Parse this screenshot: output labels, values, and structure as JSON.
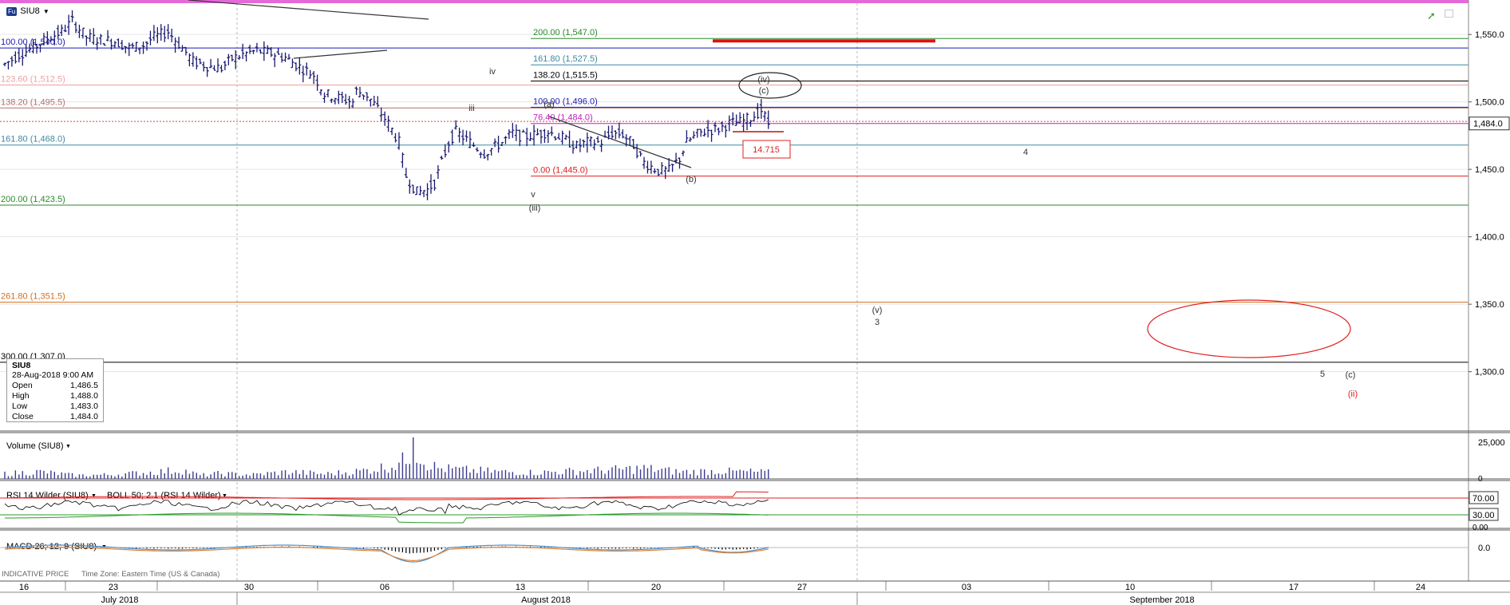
{
  "symbol": "SIU8",
  "symbol_badge": "Fu",
  "chart_data": {
    "type": "ohlc",
    "title": "SIU8",
    "y_axis": {
      "range": [
        1256,
        1572
      ],
      "ticks": [
        1300,
        1350,
        1400,
        1450,
        1500,
        1550
      ],
      "tick_labels": [
        "1,300.0",
        "1,350.0",
        "1,400.0",
        "1,450.0",
        "1,500.0",
        "1,550.0"
      ]
    },
    "last_price_label": "1,484.0",
    "x_axis": {
      "ticks": [
        "16",
        "23",
        "30",
        "06",
        "13",
        "20",
        "27",
        "03",
        "10",
        "17",
        "24"
      ],
      "months": [
        "July 2018",
        "August 2018",
        "September 2018"
      ]
    },
    "price_path": [
      [
        0,
        1528
      ],
      [
        4,
        1535
      ],
      [
        8,
        1540
      ],
      [
        12,
        1547
      ],
      [
        16,
        1552
      ],
      [
        19,
        1560
      ],
      [
        23,
        1548
      ],
      [
        27,
        1546
      ],
      [
        31,
        1545
      ],
      [
        35,
        1540
      ],
      [
        39,
        1542
      ],
      [
        42,
        1548
      ],
      [
        46,
        1552
      ],
      [
        50,
        1540
      ],
      [
        53,
        1530
      ],
      [
        58,
        1526
      ],
      [
        61,
        1525
      ],
      [
        64,
        1532
      ],
      [
        68,
        1536
      ],
      [
        71,
        1538
      ],
      [
        75,
        1536
      ],
      [
        79,
        1533
      ],
      [
        83,
        1526
      ],
      [
        87,
        1520
      ],
      [
        90,
        1506
      ],
      [
        94,
        1503
      ],
      [
        98,
        1500
      ],
      [
        99,
        1508
      ],
      [
        102,
        1505
      ],
      [
        105,
        1495
      ],
      [
        108,
        1484
      ],
      [
        111,
        1470
      ],
      [
        113,
        1445
      ],
      [
        116,
        1433
      ],
      [
        119,
        1435
      ],
      [
        121,
        1440
      ],
      [
        125,
        1470
      ],
      [
        127,
        1478
      ],
      [
        131,
        1470
      ],
      [
        135,
        1462
      ],
      [
        140,
        1470
      ],
      [
        143,
        1477
      ],
      [
        146,
        1474
      ],
      [
        150,
        1476
      ],
      [
        153,
        1478
      ],
      [
        157,
        1473
      ],
      [
        161,
        1467
      ],
      [
        164,
        1470
      ],
      [
        168,
        1470
      ],
      [
        171,
        1477
      ],
      [
        174,
        1476
      ],
      [
        177,
        1468
      ],
      [
        180,
        1455
      ],
      [
        184,
        1449
      ],
      [
        187,
        1449
      ],
      [
        190,
        1458
      ],
      [
        192,
        1470
      ],
      [
        195,
        1476
      ],
      [
        198,
        1479
      ],
      [
        201,
        1480
      ],
      [
        204,
        1484
      ],
      [
        207,
        1485
      ],
      [
        210,
        1488
      ],
      [
        213,
        1494
      ],
      [
        215,
        1484
      ]
    ],
    "volume_path": [
      [
        0,
        0.15
      ],
      [
        10,
        0.2
      ],
      [
        20,
        0.1
      ],
      [
        30,
        0.12
      ],
      [
        40,
        0.18
      ],
      [
        50,
        0.25
      ],
      [
        55,
        0.1
      ],
      [
        60,
        0.15
      ],
      [
        70,
        0.12
      ],
      [
        80,
        0.2
      ],
      [
        90,
        0.14
      ],
      [
        100,
        0.22
      ],
      [
        105,
        0.3
      ],
      [
        110,
        0.4
      ],
      [
        113,
        0.55
      ],
      [
        115,
        0.9
      ],
      [
        118,
        0.5
      ],
      [
        122,
        0.3
      ],
      [
        130,
        0.25
      ],
      [
        140,
        0.2
      ],
      [
        150,
        0.18
      ],
      [
        160,
        0.22
      ],
      [
        170,
        0.25
      ],
      [
        180,
        0.3
      ],
      [
        190,
        0.2
      ],
      [
        200,
        0.22
      ],
      [
        210,
        0.2
      ],
      [
        215,
        0.18
      ]
    ],
    "volume_axis": {
      "labels": [
        "25,000",
        "0"
      ]
    },
    "rsi_axis": {
      "labels": [
        "70.00",
        "30.00",
        "0.00"
      ]
    },
    "macd_axis": {
      "labels": [
        "0.0"
      ]
    },
    "fib_levels": [
      {
        "label": "100.00 (1,540.0)",
        "price": 1540.0,
        "color": "#1a1ab0",
        "side": "left"
      },
      {
        "label": "123.60 (1,512.5)",
        "price": 1512.5,
        "color": "#f0a0a0",
        "side": "left"
      },
      {
        "label": "138.20 (1,495.5)",
        "price": 1495.5,
        "color": "#b07070",
        "side": "left"
      },
      {
        "label": "161.80 (1,468.0)",
        "price": 1468.0,
        "color": "#3a8aa0",
        "side": "left"
      },
      {
        "label": "200.00 (1,423.5)",
        "price": 1423.5,
        "color": "#2a8a2a",
        "side": "left"
      },
      {
        "label": "261.80 (1,351.5)",
        "price": 1351.5,
        "color": "#d07020",
        "side": "left"
      },
      {
        "label": "300.00 (1,307.0)",
        "price": 1307.0,
        "color": "#000000",
        "side": "left"
      },
      {
        "label": "200.00 (1,547.0)",
        "price": 1547.0,
        "color": "#2a8a2a",
        "side": "right"
      },
      {
        "label": "161.80 (1,527.5)",
        "price": 1527.5,
        "color": "#3a8aa0",
        "side": "right"
      },
      {
        "label": "138.20 (1,515.5)",
        "price": 1515.5,
        "color": "#000000",
        "side": "right"
      },
      {
        "label": "100.00 (1,496.0)",
        "price": 1496.0,
        "color": "#1a1ab0",
        "side": "right"
      },
      {
        "label": "76.40 (1,484.0)",
        "price": 1484.0,
        "color": "#c020c0",
        "side": "right"
      },
      {
        "label": "0.00 (1,445.0)",
        "price": 1445.0,
        "color": "#e02020",
        "side": "right"
      }
    ],
    "wave_labels": [
      {
        "text": "iv",
        "color": "#333333"
      },
      {
        "text": "iii",
        "color": "#333333"
      },
      {
        "text": "v",
        "color": "#333333"
      },
      {
        "text": "(iii)",
        "color": "#333333"
      },
      {
        "text": "(a)",
        "color": "#333333"
      },
      {
        "text": "(b)",
        "color": "#333333"
      },
      {
        "text": "(iv)",
        "color": "#333333"
      },
      {
        "text": "(c)",
        "color": "#333333"
      },
      {
        "text": "4",
        "color": "#333333"
      },
      {
        "text": "(v)",
        "color": "#333333"
      },
      {
        "text": "3",
        "color": "#333333"
      },
      {
        "text": "5",
        "color": "#333333"
      },
      {
        "text": "(c)",
        "color": "#333333"
      },
      {
        "text": "(ii)",
        "color": "#e02020"
      }
    ],
    "annotation_box": "14.715"
  },
  "ohlc_box": {
    "symbol": "SIU8",
    "date": "28-Aug-2018 9:00 AM",
    "rows": [
      {
        "label": "Open",
        "value": "1,486.5"
      },
      {
        "label": "High",
        "value": "1,488.0"
      },
      {
        "label": "Low",
        "value": "1,483.0"
      },
      {
        "label": "Close",
        "value": "1,484.0"
      }
    ]
  },
  "panels": {
    "volume": "Volume (SIU8)",
    "rsi": "RSI 14 Wilder (SIU8)",
    "boll": "BOLL 50; 2.1 (RSI 14 Wilder)",
    "macd": "MACD 26; 12; 9 (SIU8)"
  },
  "footer": {
    "indicative": "INDICATIVE PRICE",
    "timezone": "Time Zone: Eastern Time (US & Canada)"
  },
  "colors": {
    "price": "#1a1a70",
    "volume": "#3a3a90",
    "rsi": "#000000",
    "boll_upper": "#e02020",
    "boll_lower": "#2a9a2a",
    "macd": "#000000",
    "macd_fast": "#4a90d0",
    "macd_slow": "#e08030"
  }
}
